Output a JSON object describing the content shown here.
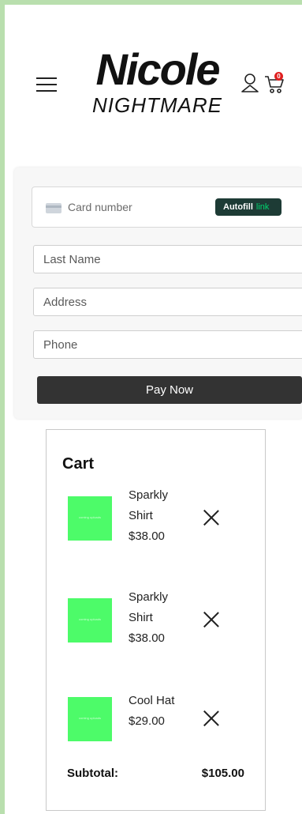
{
  "header": {
    "brand_top": "Nicole",
    "brand_bottom": "NIGHTMARE",
    "cart_count": "0",
    "icons": [
      "menu-icon",
      "user-icon",
      "cart-icon"
    ]
  },
  "checkout": {
    "card_placeholder": "Card number",
    "autofill_label": "Autofill",
    "autofill_brand": "link",
    "last_name_placeholder": "Last Name",
    "address_placeholder": "Address",
    "phone_placeholder": "Phone",
    "pay_label": "Pay Now"
  },
  "cart": {
    "title": "Cart",
    "items": [
      {
        "name": "Sparkly Shirt",
        "price": "$38.00",
        "thumb_text": "coming uploads"
      },
      {
        "name": "Sparkly Shirt",
        "price": "$38.00",
        "thumb_text": "coming uploads"
      },
      {
        "name": "Cool Hat",
        "price": "$29.00",
        "thumb_text": "coming uploads"
      }
    ],
    "subtotal_label": "Subtotal:",
    "subtotal_value": "$105.00"
  },
  "colors": {
    "frame": "#b9dfae",
    "button": "#333333",
    "thumb": "#4dfb69",
    "badge": "#e02020",
    "link_bg": "#1d3b35",
    "link_accent": "#00d66f"
  }
}
